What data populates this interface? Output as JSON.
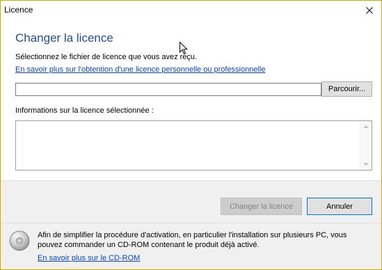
{
  "window": {
    "title": "Licence"
  },
  "header": {
    "heading": "Changer la licence"
  },
  "main": {
    "instruction": "Sélectionnez le fichier de licence que vous avez reçu.",
    "licence_link": "En savoir plus sur l'obtention d'une licence personnelle ou professionnelle",
    "path_input": {
      "value": "",
      "placeholder": ""
    },
    "browse_label": "Parcourir...",
    "info_label": "Informations sur la licence sélectionnée :",
    "info_text": ""
  },
  "actions": {
    "change_label": "Changer la licence",
    "change_enabled": false,
    "cancel_label": "Annuler"
  },
  "cdrom": {
    "text": "Afin de simplifier la procédure d'activation, en particulier l'installation sur plusieurs PC, vous pouvez commander un CD-ROM contenant le produit déjà activé.",
    "link": "En savoir plus sur le CD-ROM",
    "icon": "cd-rom-icon"
  },
  "colors": {
    "heading": "#1f4e9b",
    "link": "#0645c8",
    "window_border": "#d8a600",
    "focus_border": "#0078d7"
  }
}
